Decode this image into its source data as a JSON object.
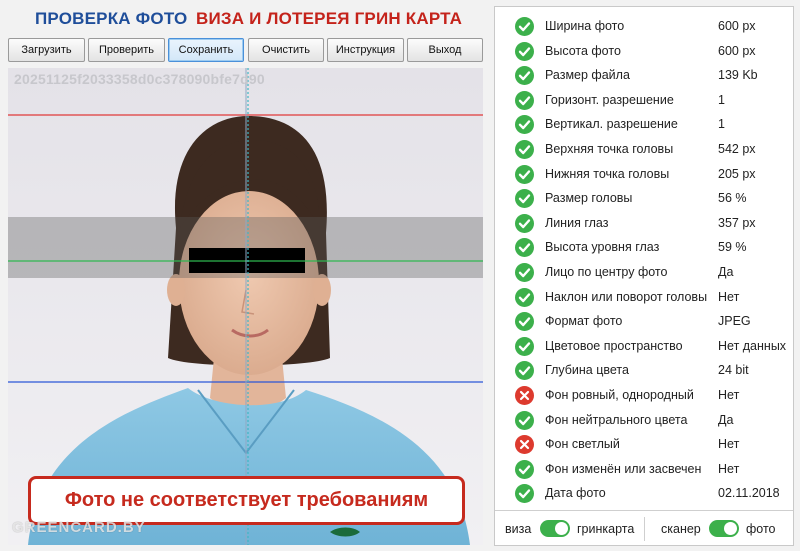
{
  "header": {
    "left_title": "ПРОВЕРКА ФОТО",
    "right_title": "ВИЗА И ЛОТЕРЕЯ ГРИН КАРТА"
  },
  "toolbar": {
    "load": "Загрузить",
    "check": "Проверить",
    "save": "Сохранить",
    "clear": "Очистить",
    "manual": "Инструкция",
    "exit": "Выход"
  },
  "photo": {
    "hash": "20251125f2033358d0c378090bfe7d90",
    "watermark": "GREENCARD.BY",
    "verdict": "Фото не соответствует требованиям"
  },
  "checks": [
    {
      "label": "Ширина фото",
      "value": "600 px",
      "status": "ok"
    },
    {
      "label": "Высота фото",
      "value": "600 px",
      "status": "ok"
    },
    {
      "label": "Размер файла",
      "value": "139 Kb",
      "status": "ok"
    },
    {
      "label": "Горизонт. разрешение",
      "value": "1",
      "status": "ok"
    },
    {
      "label": "Вертикал. разрешение",
      "value": "1",
      "status": "ok"
    },
    {
      "label": "Верхняя точка головы",
      "value": "542 px",
      "status": "ok"
    },
    {
      "label": "Нижняя точка головы",
      "value": "205 px",
      "status": "ok"
    },
    {
      "label": "Размер головы",
      "value": "56 %",
      "status": "ok"
    },
    {
      "label": "Линия глаз",
      "value": "357 px",
      "status": "ok"
    },
    {
      "label": "Высота уровня глаз",
      "value": "59 %",
      "status": "ok"
    },
    {
      "label": "Лицо по центру фото",
      "value": "Да",
      "status": "ok"
    },
    {
      "label": "Наклон или поворот головы",
      "value": "Нет",
      "status": "ok"
    },
    {
      "label": "Формат фото",
      "value": "JPEG",
      "status": "ok"
    },
    {
      "label": "Цветовое пространство",
      "value": "Нет данных",
      "status": "ok"
    },
    {
      "label": "Глубина цвета",
      "value": "24 bit",
      "status": "ok"
    },
    {
      "label": "Фон ровный, однородный",
      "value": "Нет",
      "status": "bad"
    },
    {
      "label": "Фон нейтрального цвета",
      "value": "Да",
      "status": "ok"
    },
    {
      "label": "Фон светлый",
      "value": "Нет",
      "status": "bad"
    },
    {
      "label": "Фон изменён или засвечен",
      "value": "Нет",
      "status": "ok"
    },
    {
      "label": "Дата фото",
      "value": "02.11.2018",
      "status": "ok"
    }
  ],
  "mode": {
    "left_off": "виза",
    "left_on": "гринкарта",
    "left_toggle_on": true,
    "right_off": "сканер",
    "right_on": "фото",
    "right_toggle_on": true
  },
  "colors": {
    "ok": "#3cb04b",
    "bad": "#dd3a2e",
    "accent_blue": "#1f4e9a",
    "accent_red": "#c4231b"
  }
}
